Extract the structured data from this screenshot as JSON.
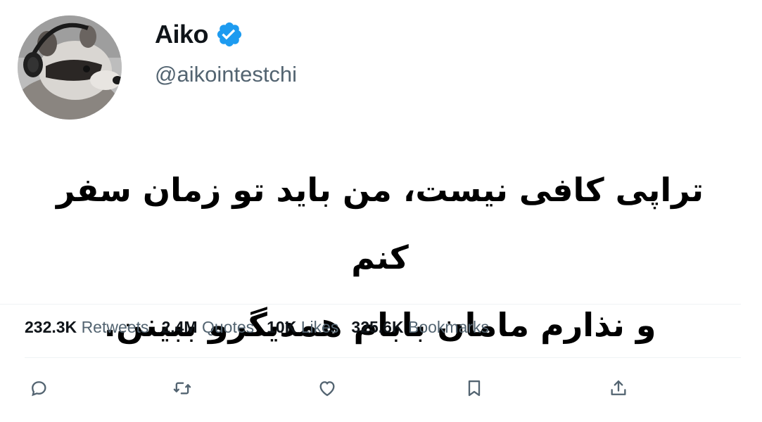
{
  "user": {
    "display_name": "Aiko",
    "handle": "@aikointestchi",
    "verified_color": "#1d9bf0"
  },
  "tweet": {
    "line1": "تراپی کافی نیست، من باید تو زمان سفر کنم",
    "line2": "و نذارم مامان بابام همدیگرو ببینن."
  },
  "stats": [
    {
      "value": "232.3K",
      "label": "Retweets"
    },
    {
      "value": "2.4M",
      "label": "Quotes"
    },
    {
      "value": "10K",
      "label": "Likes"
    },
    {
      "value": "325.6K",
      "label": "Bookmarks"
    }
  ],
  "actions": [
    {
      "name": "reply-icon"
    },
    {
      "name": "retweet-icon"
    },
    {
      "name": "like-icon"
    },
    {
      "name": "bookmark-icon"
    },
    {
      "name": "share-icon"
    }
  ],
  "colors": {
    "secondary_text": "#536471",
    "primary_text": "#0f1419",
    "divider": "#eff3f4"
  }
}
